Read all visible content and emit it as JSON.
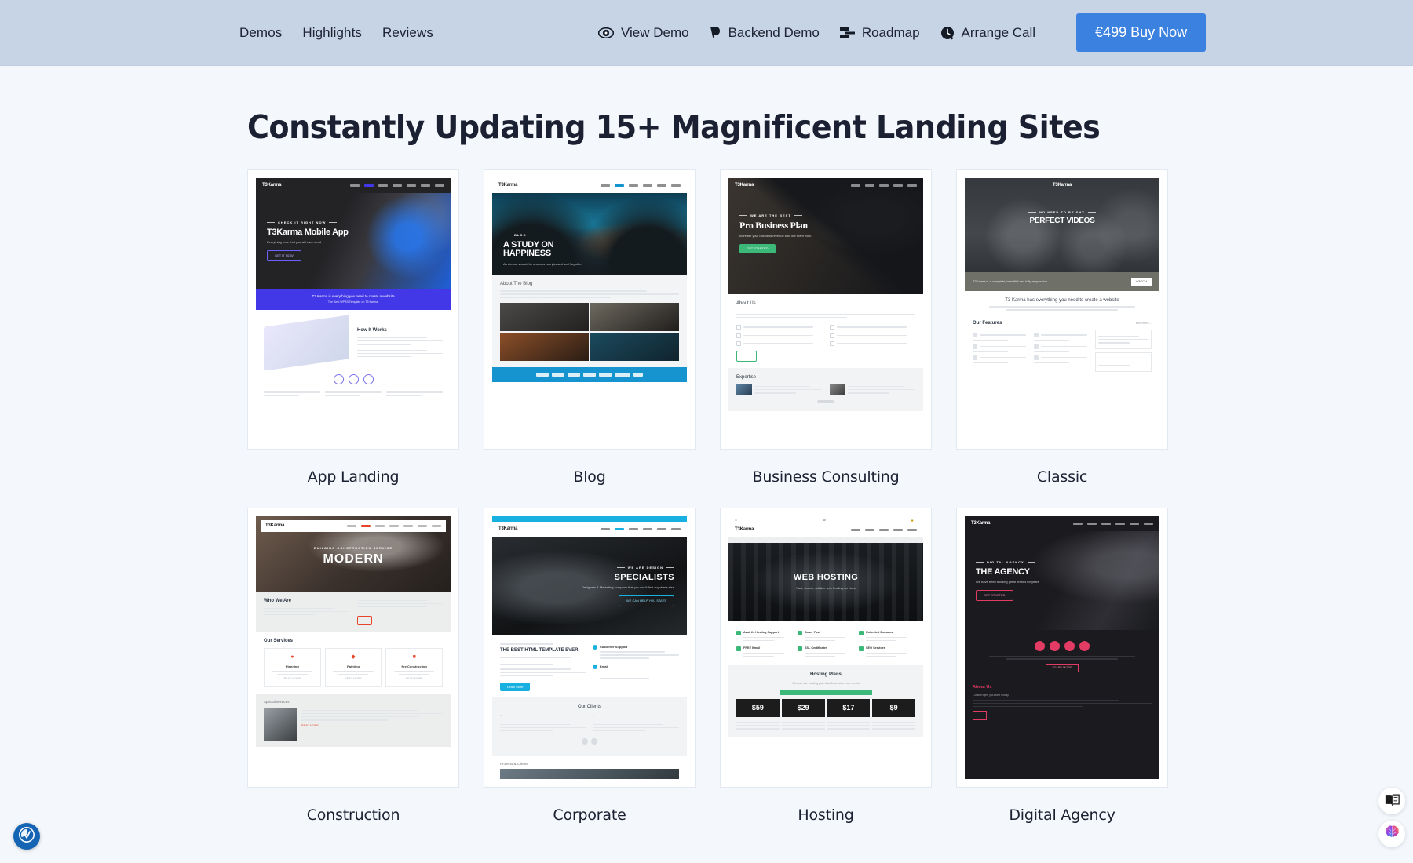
{
  "header": {
    "nav_links": [
      {
        "label": "Demos"
      },
      {
        "label": "Highlights"
      },
      {
        "label": "Reviews"
      }
    ],
    "icon_links": [
      {
        "label": "View Demo",
        "icon": "eye-icon"
      },
      {
        "label": "Backend Demo",
        "icon": "backend-icon"
      },
      {
        "label": "Roadmap",
        "icon": "roadmap-icon"
      },
      {
        "label": "Arrange Call",
        "icon": "phone-clock-icon"
      }
    ],
    "cta_label": "€499 Buy Now",
    "cta_color": "#3b82e0",
    "background_color": "#c7d4e6"
  },
  "main": {
    "title": "Constantly Updating 15+ Magnificent Landing Sites"
  },
  "demos": [
    {
      "label": "App Landing",
      "brand": "T3Karma",
      "hero_kicker": "CHECK IT RIGHT NOW",
      "hero_title": "T3Karma Mobile App",
      "hero_sub": "Everything here that you will ever need",
      "hero_btn": "GET IT NOW",
      "band_line1": "T3 Karma is everything you need to create a website",
      "band_line2": "The Best WPBS Template on T3 Karma!",
      "section_title": "How It Works",
      "accent": "#4338e8",
      "hero_bg": "#232326"
    },
    {
      "label": "Blog",
      "brand": "T3Karma",
      "hero_kicker": "BLOG",
      "hero_title": "A STUDY ON HAPPINESS",
      "hero_sub": "An eternal search for answers has pleased and forgotten",
      "section_title": "About The Blog",
      "accent": "#1694cf",
      "hero_bg": "#17505f"
    },
    {
      "label": "Business Consulting",
      "brand": "T3Karma",
      "hero_kicker": "WE ARE THE BEST",
      "hero_title": "Pro Business Plan",
      "hero_sub": "Increase your business revenue with our team work",
      "hero_btn": "GET STARTED",
      "section_title": "About Us",
      "section_title2": "Expertise",
      "accent": "#3cb878",
      "hero_bg": "#2b2b2b"
    },
    {
      "label": "Classic",
      "brand": "T3Karma",
      "hero_kicker": "NO NEED TO BE SHY",
      "hero_title": "PERFECT VIDEOS",
      "hero_sub": "T3 Karma has everything you need to create a website",
      "hero_btn": "WATCH",
      "band_line": "T3Karma is a complete, beautiful and fully responsive",
      "section_title": "Our Features",
      "section_title2": "and more...",
      "accent": "#5c6470",
      "hero_bg": "#2f3237"
    },
    {
      "label": "Construction",
      "brand": "T3Karma",
      "hero_kicker": "BUILDING CONSTRUCTION SERVICE",
      "hero_title": "MODERN",
      "section_title": "Who We Are",
      "section_title2": "Our Services",
      "section_title3": "Special services",
      "services": [
        {
          "name": "Planning",
          "icon": "flame-icon"
        },
        {
          "name": "Painting",
          "icon": "brush-icon"
        },
        {
          "name": "Pre Construction",
          "icon": "tool-icon"
        }
      ],
      "btn": "READ MORE",
      "accent": "#e8442a",
      "hero_bg": "#4b3c36"
    },
    {
      "label": "Corporate",
      "brand": "T3Karma",
      "hero_kicker": "WE ARE DESIGN",
      "hero_title": "SPECIALISTS",
      "hero_sub": "Designers & Marketing company that you won't find anywhere else",
      "hero_btn": "WE CAN HELP YOU START",
      "section_title": "THE BEST HTML TEMPLATE EVER",
      "section_title2": "Our Clients",
      "section_title3": "Projects & Clients",
      "features": [
        {
          "name": "Customer Support"
        },
        {
          "name": "Email"
        }
      ],
      "btn": "Learn More",
      "accent": "#18b0e0",
      "hero_bg": "#1d1f22"
    },
    {
      "label": "Hosting",
      "brand": "T3Karma",
      "hero_title": "WEB HOSTING",
      "hero_sub": "Fast, secure, reliable web hosting services",
      "features": [
        {
          "name": "Avail 24 Hosting Support"
        },
        {
          "name": "Super Fast"
        },
        {
          "name": "Unlimited Domains"
        },
        {
          "name": "FREE Email"
        },
        {
          "name": "SSL Certificates"
        },
        {
          "name": "SEO Services"
        }
      ],
      "pricing_title": "Hosting Plans",
      "pricing_sub": "Choose the hosting plan that best suits your needs",
      "plans": [
        {
          "price": "$59"
        },
        {
          "price": "$29"
        },
        {
          "price": "$17",
          "highlight": true
        },
        {
          "price": "$9"
        }
      ],
      "accent": "#3cb878",
      "hero_bg": "#17191c"
    },
    {
      "label": "Digital Agency",
      "brand": "T3Karma",
      "hero_kicker": "DIGITAL AGENCY",
      "hero_title": "THE AGENCY",
      "hero_sub": "We have been building great brands for years",
      "hero_btn": "GET STARTED",
      "section_title": "About Us",
      "section_title2": "Challenges yourself today",
      "btn": "LEARN MORE",
      "accent": "#e23b64",
      "hero_bg": "#1b1b1f"
    }
  ],
  "widgets": {
    "accessibility": {
      "icon": "accessibility-icon",
      "color": "#1565b4"
    },
    "dock": [
      {
        "icon": "book-icon"
      },
      {
        "icon": "brain-icon"
      }
    ]
  }
}
